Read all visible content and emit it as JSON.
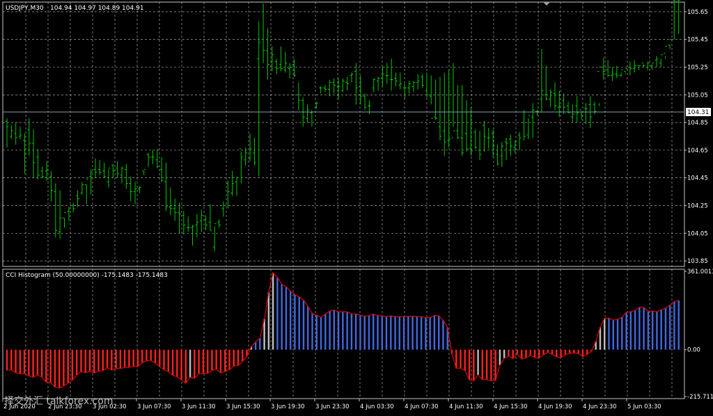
{
  "main": {
    "symbol": "USDJPY,M30",
    "ohlc": "104.94 104.97 104.89 104.91",
    "price_labels": [
      "105.65",
      "105.45",
      "105.25",
      "105.05",
      "104.85",
      "104.65",
      "104.45",
      "104.25",
      "104.05",
      "103.85"
    ],
    "price_values": [
      105.65,
      105.45,
      105.25,
      105.05,
      104.85,
      104.65,
      104.45,
      104.25,
      104.05,
      103.85
    ],
    "current_price": "104.31",
    "current_price_value": 104.91,
    "price_range": [
      103.81,
      105.72
    ],
    "colors": {
      "background": "#000000",
      "grid": "#c8c8c8",
      "bars": "#00c800",
      "axis_text": "#ffffff",
      "current_line": "#7f9db9"
    }
  },
  "indicator": {
    "title": "CCI Histogram (50.00000000) -175.1483 -175.1483",
    "scale_labels": [
      "361.0013",
      "0.00",
      "-215.711"
    ],
    "scale_values": [
      361.0013,
      0,
      -215.711
    ],
    "colors": {
      "up": "#4169e1",
      "down": "#ff2020",
      "neutral": "#c0c0c0",
      "outline": "#e00000"
    }
  },
  "time_labels": [
    "2 Jun 2020",
    "2 Jun 23:30",
    "3 Jun 02:30",
    "3 Jun 07:30",
    "3 Jun 11:30",
    "3 Jun 15:30",
    "3 Jun 19:30",
    "3 Jun 23:30",
    "4 Jun 03:30",
    "4 Jun 07:30",
    "4 Jun 11:30",
    "4 Jun 15:30",
    "4 Jun 19:30",
    "4 Jun 23:30",
    "5 Jun 03:30"
  ],
  "watermark": "择交外汇 talkforex.com",
  "chart_data": [
    {
      "type": "ohlc",
      "title": "USDJPY,M30",
      "ylim": [
        103.81,
        105.72
      ],
      "series": [
        {
          "name": "USDJPY",
          "high": [
            104.88,
            104.83,
            104.85,
            104.82,
            104.77,
            104.88,
            104.8,
            104.66,
            104.53,
            104.57,
            104.5,
            104.41,
            104.36,
            104.16,
            104.24,
            104.27,
            104.36,
            104.42,
            104.4,
            104.51,
            104.59,
            104.58,
            104.56,
            104.51,
            104.55,
            104.57,
            104.53,
            104.55,
            104.46,
            104.42,
            104.39,
            104.5,
            104.63,
            104.65,
            104.66,
            104.6,
            104.56,
            104.38,
            104.3,
            104.27,
            104.21,
            104.17,
            104.11,
            104.19,
            104.22,
            104.18,
            104.26,
            104.1,
            104.15,
            104.28,
            104.43,
            104.5,
            104.46,
            104.64,
            104.67,
            104.77,
            104.74,
            105.58,
            105.71,
            105.53,
            105.4,
            105.31,
            105.4,
            105.36,
            105.28,
            105.31,
            105.14,
            105.03,
            104.98,
            104.94,
            105.0,
            105.11,
            105.12,
            105.16,
            105.17,
            105.17,
            105.17,
            105.18,
            105.21,
            105.28,
            105.19,
            105.06,
            105.01,
            105.17,
            105.18,
            105.26,
            105.28,
            105.31,
            105.21,
            105.21,
            105.13,
            105.15,
            105.15,
            105.2,
            105.2,
            105.21,
            105.19,
            105.16,
            105.18,
            105.21,
            105.23,
            105.28,
            105.12,
            105.12,
            105.01,
            104.96,
            104.8,
            104.79,
            104.86,
            104.81,
            104.8,
            104.69,
            104.71,
            104.74,
            104.76,
            104.72,
            104.78,
            104.94,
            104.88,
            104.99,
            104.94,
            105.38,
            105.26,
            105.09,
            105.14,
            105.08,
            105.06,
            105.0,
            104.98,
            105.04,
            104.93,
            104.99,
            105.04,
            105.0,
            104.99,
            105.32,
            105.3,
            105.25,
            105.26,
            105.21,
            105.2,
            105.29,
            105.3,
            105.25,
            105.27,
            105.29,
            105.27,
            105.33,
            105.31,
            105.31,
            105.38,
            105.45,
            105.49
          ],
          "low": [
            104.67,
            104.73,
            104.69,
            104.73,
            104.48,
            104.61,
            104.45,
            104.44,
            104.45,
            104.43,
            104.28,
            104.02,
            104.01,
            104.09,
            104.14,
            104.2,
            104.24,
            104.33,
            104.26,
            104.33,
            104.45,
            104.47,
            104.45,
            104.38,
            104.45,
            104.45,
            104.41,
            104.37,
            104.28,
            104.26,
            104.34,
            104.47,
            104.53,
            104.55,
            104.52,
            104.42,
            104.21,
            104.18,
            104.14,
            104.05,
            104.04,
            104.06,
            103.96,
            104.02,
            104.06,
            104.07,
            104.07,
            103.92,
            104.09,
            104.17,
            104.23,
            104.32,
            104.32,
            104.41,
            104.54,
            104.57,
            104.54,
            104.46,
            105.28,
            105.16,
            105.22,
            105.2,
            105.22,
            105.21,
            105.17,
            105.18,
            104.94,
            104.82,
            104.85,
            104.82,
            104.95,
            105.06,
            105.07,
            105.04,
            105.06,
            105.02,
            105.07,
            105.08,
            105.14,
            104.98,
            104.98,
            104.94,
            104.91,
            105.07,
            105.08,
            105.11,
            105.13,
            105.08,
            105.11,
            105.09,
            105.02,
            105.06,
            105.07,
            105.09,
            105.1,
            105.03,
            104.98,
            104.87,
            104.72,
            104.61,
            104.67,
            104.82,
            104.73,
            104.61,
            104.64,
            104.61,
            104.66,
            104.58,
            104.64,
            104.66,
            104.6,
            104.54,
            104.53,
            104.58,
            104.61,
            104.63,
            104.65,
            104.72,
            104.73,
            104.74,
            104.9,
            104.92,
            105.01,
            104.96,
            104.94,
            104.89,
            104.91,
            104.92,
            104.85,
            104.85,
            104.87,
            104.84,
            104.81,
            104.91,
            104.97,
            105.16,
            105.18,
            105.15,
            105.17,
            105.18,
            105.21,
            105.19,
            105.21,
            105.23,
            105.25,
            105.23,
            105.23,
            105.25,
            105.25,
            105.33,
            105.41
          ],
          "open": [
            104.86,
            104.75,
            104.77,
            104.75,
            104.72,
            104.8,
            104.7,
            104.6,
            104.5,
            104.5,
            104.46,
            104.35,
            104.06,
            104.16,
            104.21,
            104.25,
            104.32,
            104.34,
            104.4,
            104.46,
            104.51,
            104.51,
            104.5,
            104.42,
            104.54,
            104.52,
            104.47,
            104.51,
            104.41,
            104.35,
            104.37,
            104.5,
            104.62,
            104.6,
            104.58,
            104.51,
            104.42,
            104.24,
            104.23,
            104.2,
            104.18,
            104.09,
            104.09,
            104.11,
            104.14,
            104.15,
            104.13,
            103.95,
            104.13,
            104.23,
            104.41,
            104.34,
            104.42,
            104.66,
            104.58,
            104.59,
            104.63,
            105.31,
            105.45,
            105.37,
            105.29,
            105.29,
            105.27,
            105.23,
            105.24,
            105.27,
            105.05,
            105.01,
            104.88,
            104.92,
            104.96,
            105.1,
            105.1,
            105.09,
            105.14,
            105.11,
            105.08,
            105.14,
            105.19,
            105.22,
            105.11,
            105.04,
            104.97,
            105.1,
            105.15,
            105.17,
            105.19,
            105.16,
            105.17,
            105.12,
            105.1,
            105.1,
            105.11,
            105.14,
            105.18,
            105.08,
            105.04,
            104.89,
            104.82,
            104.79,
            104.72,
            104.74,
            104.79,
            104.74,
            104.77,
            104.66,
            104.78,
            104.65,
            104.83,
            104.74,
            104.77,
            104.62,
            104.61,
            104.71,
            104.73,
            104.67,
            104.76,
            104.85,
            104.76,
            104.89,
            104.93,
            105.02,
            105.05,
            105.02,
            105.06,
            104.96,
            105.01,
            104.97,
            104.89,
            104.97,
            104.94,
            104.95,
            104.98,
            104.98,
            105.22,
            105.25,
            105.23,
            105.19,
            105.2,
            105.19,
            105.22,
            105.25,
            105.24,
            105.26,
            105.28,
            105.25,
            105.26,
            105.3,
            105.28,
            105.35,
            105.41
          ],
          "close": [
            104.82,
            104.79,
            104.74,
            104.76,
            104.62,
            104.7,
            104.56,
            104.47,
            104.46,
            104.51,
            104.36,
            104.07,
            104.16,
            104.2,
            104.23,
            104.23,
            104.3,
            104.4,
            104.44,
            104.49,
            104.49,
            104.49,
            104.46,
            104.52,
            104.5,
            104.48,
            104.52,
            104.41,
            104.35,
            104.37,
            104.38,
            104.51,
            104.6,
            104.6,
            104.53,
            104.43,
            104.24,
            104.23,
            104.2,
            104.19,
            104.11,
            104.09,
            104.1,
            104.13,
            104.18,
            104.11,
            104.07,
            104.12,
            104.11,
            104.25,
            104.35,
            104.41,
            104.45,
            104.6,
            104.63,
            104.66,
            104.56,
            105.43,
            105.37,
            105.27,
            105.34,
            105.24,
            105.24,
            105.28,
            105.25,
            105.19,
            105.01,
            104.89,
            104.94,
            104.85,
            104.99,
            105.1,
            105.09,
            105.14,
            105.12,
            105.11,
            105.15,
            105.13,
            105.2,
            105.1,
            105.04,
            104.96,
            104.97,
            105.16,
            105.17,
            105.2,
            105.19,
            105.16,
            105.15,
            105.13,
            105.1,
            105.13,
            105.14,
            105.15,
            105.12,
            105.05,
            104.88,
            104.88,
            104.75,
            104.71,
            104.73,
            104.79,
            104.74,
            104.63,
            104.66,
            104.64,
            104.67,
            104.62,
            104.75,
            104.74,
            104.68,
            104.55,
            104.68,
            104.7,
            104.68,
            104.71,
            104.74,
            104.75,
            104.9,
            104.94,
            104.93,
            105.08,
            105.02,
            105.07,
            104.97,
            104.97,
            104.96,
            104.92,
            104.91,
            104.92,
            104.9,
            104.95,
            104.89,
            104.93,
            105.25,
            105.22,
            105.19,
            105.2,
            105.19,
            105.23,
            105.24,
            105.24,
            105.26,
            105.26,
            105.26,
            105.28,
            105.28,
            105.31,
            105.34,
            105.4,
            105.45
          ]
        }
      ]
    },
    {
      "type": "bar",
      "title": "CCI Histogram (50.00000000) -175.1483 -175.1483",
      "ylim": [
        -215.711,
        361.0013
      ],
      "series": [
        {
          "name": "CCI",
          "values": [
            -95,
            -92,
            -106,
            -111,
            -110,
            -120,
            -127,
            -117,
            -126,
            -150,
            -152,
            -172,
            -177,
            -167,
            -154,
            -140,
            -116,
            -101,
            -106,
            -99,
            -108,
            -98,
            -97,
            -83,
            -94,
            -87,
            -86,
            -82,
            -81,
            -77,
            -78,
            -60,
            -51,
            -49,
            -61,
            -78,
            -92,
            -101,
            -118,
            -124,
            -139,
            -154,
            -128,
            -132,
            -111,
            -110,
            -109,
            -96,
            -90,
            -107,
            -100,
            -92,
            -75,
            -73,
            -54,
            -31,
            14,
            35,
            53,
            141,
            264,
            354,
            334,
            301,
            290,
            269,
            254,
            243,
            228,
            199,
            167,
            159,
            149,
            165,
            178,
            183,
            174,
            175,
            174,
            165,
            165,
            159,
            154,
            157,
            164,
            158,
            155,
            152,
            156,
            153,
            152,
            152,
            154,
            154,
            153,
            152,
            147,
            148,
            158,
            156,
            135,
            103,
            -19,
            -86,
            -85,
            -97,
            -139,
            -143,
            -116,
            -138,
            -138,
            -143,
            -142,
            -72,
            -40,
            -30,
            -41,
            -20,
            -43,
            -38,
            -25,
            -36,
            -39,
            -24,
            -12,
            -21,
            -33,
            -37,
            -23,
            -17,
            -15,
            -18,
            -32,
            -22,
            -7,
            38,
            103,
            144,
            146,
            136,
            141,
            150,
            172,
            175,
            181,
            196,
            194,
            177,
            178,
            175,
            184,
            192,
            205,
            222,
            227
          ],
          "categories_note": ""
        }
      ]
    }
  ]
}
